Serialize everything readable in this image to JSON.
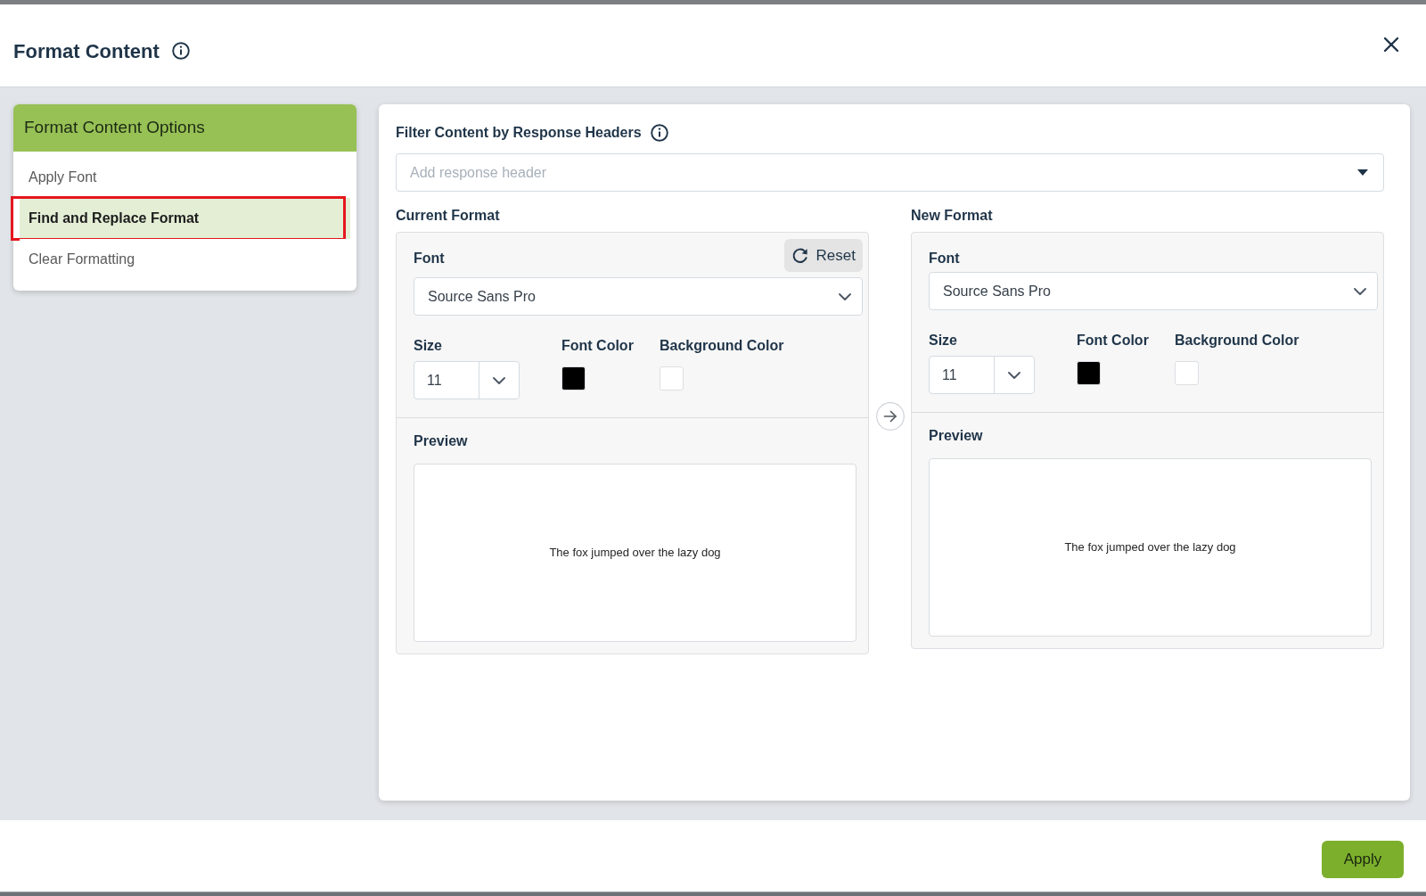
{
  "dialog": {
    "title": "Format Content"
  },
  "options_panel": {
    "title": "Format Content Options",
    "items": [
      {
        "label": "Apply Font",
        "selected": false,
        "highlighted": false
      },
      {
        "label": "Find and Replace Format",
        "selected": true,
        "highlighted": true
      },
      {
        "label": "Clear Formatting",
        "selected": false,
        "highlighted": false
      }
    ]
  },
  "filter": {
    "label": "Filter Content by Response Headers",
    "placeholder": "Add response header"
  },
  "formats": [
    {
      "heading": "Current Format",
      "reset": {
        "label": "Reset"
      },
      "font_label": "Font",
      "font": "Source Sans Pro",
      "size_label": "Size",
      "size": "11",
      "swatches": [
        {
          "label": "Font Color",
          "color": "#000000"
        },
        {
          "label": "Background Color",
          "color": "#ffffff"
        }
      ],
      "preview_label": "Preview",
      "preview_text": "The fox jumped over the lazy dog"
    },
    {
      "heading": "New Format",
      "font_label": "Font",
      "font": "Source Sans Pro",
      "size_label": "Size",
      "size": "11",
      "swatches": [
        {
          "label": "Font Color",
          "color": "#000000"
        },
        {
          "label": "Background Color",
          "color": "#ffffff"
        }
      ],
      "preview_label": "Preview",
      "preview_text": "The fox jumped over the lazy dog"
    }
  ],
  "buttons": [
    {
      "label": "Apply"
    }
  ]
}
